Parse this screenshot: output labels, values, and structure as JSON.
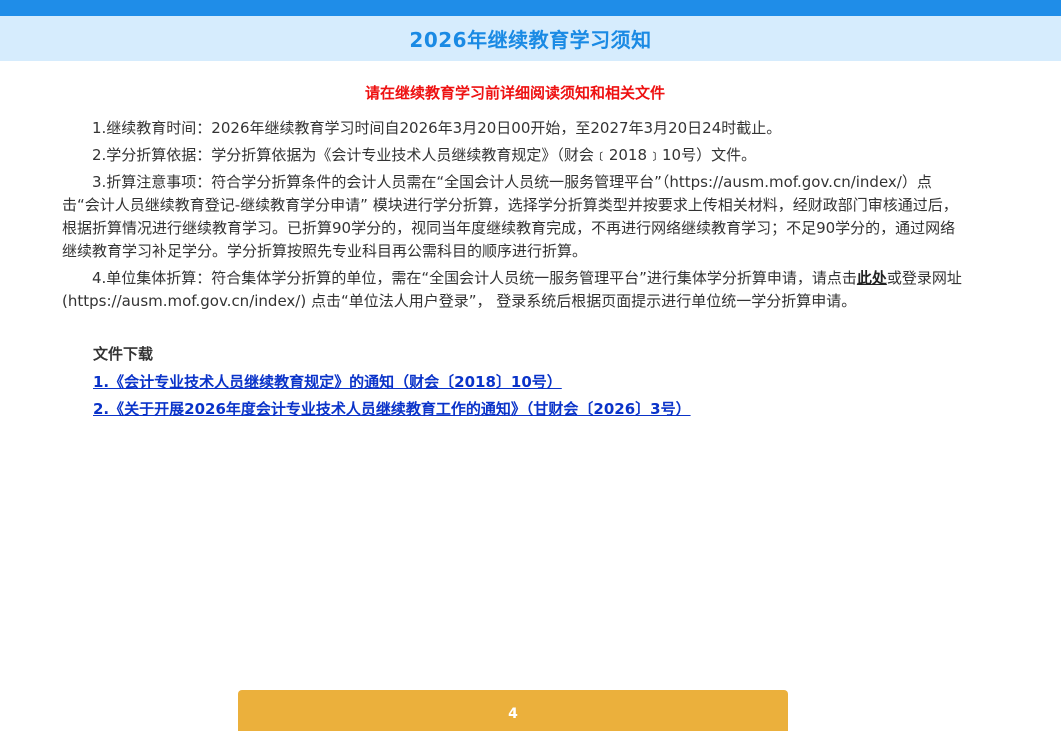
{
  "header": {
    "title": "2026年继续教育学习须知"
  },
  "notice": {
    "warning": "请在继续教育学习前详细阅读须知和相关文件",
    "items": [
      {
        "text": "1.继续教育时间：2026年继续教育学习时间自2026年3月20日00开始，至2027年3月20日24时截止。"
      },
      {
        "text": "2.学分折算依据：学分折算依据为《会计专业技术人员继续教育规定》（财会﹝2018﹞10号）文件。"
      },
      {
        "text": "3.折算注意事项：符合学分折算条件的会计人员需在“全国会计人员统一服务管理平台”（https://ausm.mof.gov.cn/index/）点击“会计人员继续教育登记-继续教育学分申请” 模块进行学分折算，选择学分折算类型并按要求上传相关材料，经财政部门审核通过后，根据折算情况进行继续教育学习。已折算90学分的，视同当年度继续教育完成，不再进行网络继续教育学习；不足90学分的，通过网络继续教育学习补足学分。学分折算按照先专业科目再公需科目的顺序进行折算。"
      },
      {
        "text_before": "4.单位集体折算：符合集体学分折算的单位，需在“全国会计人员统一服务管理平台”进行集体学分折算申请，请点击",
        "link": "此处",
        "text_after": "或登录网址(https://ausm.mof.gov.cn/index/) 点击“单位法人用户登录”， 登录系统后根据页面提示进行单位统一学分折算申请。"
      }
    ]
  },
  "downloads": {
    "title": "文件下载",
    "files": [
      "1.《会计专业技术人员继续教育规定》的通知（财会〔2018〕10号）",
      "2.《关于开展2026年度会计专业技术人员继续教育工作的通知》（甘财会〔2026〕3号）"
    ]
  },
  "countdown": {
    "label": "4"
  },
  "colors": {
    "top_strip": "#1f8de8",
    "title_bar": "#d6ecfd",
    "title_text": "#1a8ae4",
    "warning": "#ee1111",
    "link": "#0a33c9",
    "button": "#ebb03c"
  }
}
